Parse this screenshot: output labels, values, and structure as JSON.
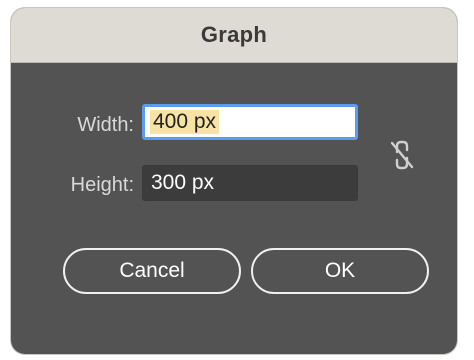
{
  "dialog": {
    "title": "Graph",
    "width_label": "Width:",
    "width_value": "400 px",
    "height_label": "Height:",
    "height_value": "300 px",
    "link_icon": "unlinked-chain-icon",
    "cancel_label": "Cancel",
    "ok_label": "OK"
  }
}
